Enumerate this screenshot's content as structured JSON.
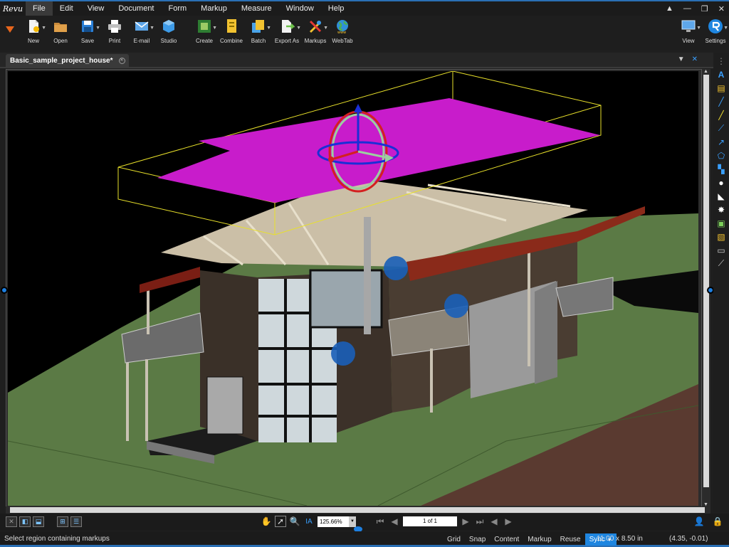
{
  "app": {
    "logo_text": "Revu"
  },
  "menu": {
    "items": [
      "File",
      "Edit",
      "View",
      "Document",
      "Form",
      "Markup",
      "Measure",
      "Window",
      "Help"
    ],
    "active": "File"
  },
  "window_controls": {
    "help": "▲",
    "minimize": "—",
    "restore": "❐",
    "close": "✕"
  },
  "toolbar": {
    "new": "New",
    "open": "Open",
    "save": "Save",
    "print": "Print",
    "email": "E-mail",
    "studio": "Studio",
    "create": "Create",
    "combine": "Combine",
    "batch": "Batch",
    "export_as": "Export As",
    "markups": "Markups",
    "webtab": "WebTab",
    "view": "View",
    "settings": "Settings"
  },
  "document_tab": {
    "title": "Basic_sample_project_house*"
  },
  "navigation": {
    "zoom": "125.66%",
    "page": "1 of 1"
  },
  "status": {
    "message": "Select region containing markups",
    "toggles": [
      "Grid",
      "Snap",
      "Content",
      "Markup",
      "Reuse",
      "Sync"
    ],
    "active_toggle": "Sync",
    "page_size": "11.00 x 8.50 in",
    "cursor": "(4.35, -0.01)"
  },
  "colors": {
    "accent": "#2a6fb5",
    "sync_active": "#1f86e0",
    "selected_slab": "#c81ccb",
    "bounding_box": "#e8e02a",
    "ground": "#5b7a45",
    "walls": "#3a3028",
    "roof": "#cbbfa7",
    "awning": "#8a2a1a",
    "marker": "#1a5fb8"
  },
  "icons": {
    "new": "new-document-icon",
    "open": "folder-icon",
    "save": "floppy-icon",
    "print": "printer-icon",
    "email": "envelope-icon",
    "studio": "cube-icon",
    "create": "create-icon",
    "combine": "combine-icon",
    "batch": "batch-icon",
    "export_as": "export-icon",
    "markups": "markups-icon",
    "webtab": "globe-icon",
    "view": "monitor-icon",
    "settings": "revu-logo-icon"
  }
}
